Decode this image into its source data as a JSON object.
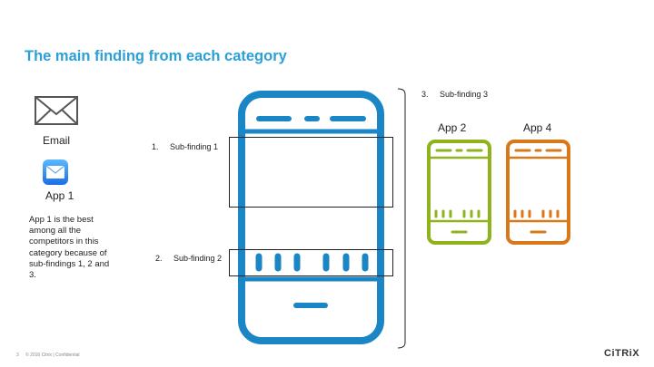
{
  "slide": {
    "title": "The main finding from each category",
    "email_label": "Email",
    "app1_label": "App 1",
    "description": "App 1 is the best among all the competitors in this category because of sub-findings 1, 2 and 3.",
    "sub_findings": [
      {
        "number": "1.",
        "label": "Sub-finding 1"
      },
      {
        "number": "2.",
        "label": "Sub-finding 2"
      },
      {
        "number": "3.",
        "label": "Sub-finding 3"
      }
    ],
    "app2_label": "App 2",
    "app4_label": "App 4",
    "footer_page": "3",
    "footer_copy": "© 2016 Citrix | Confidential",
    "logo": "CiTRiX"
  },
  "colors": {
    "title": "#2b9fd8",
    "main_phone": "#1a86c6",
    "app2_phone": "#8fb31d",
    "app4_phone": "#d9781a"
  },
  "icons": [
    "envelope-icon",
    "mail-app-icon",
    "phone-icon"
  ]
}
